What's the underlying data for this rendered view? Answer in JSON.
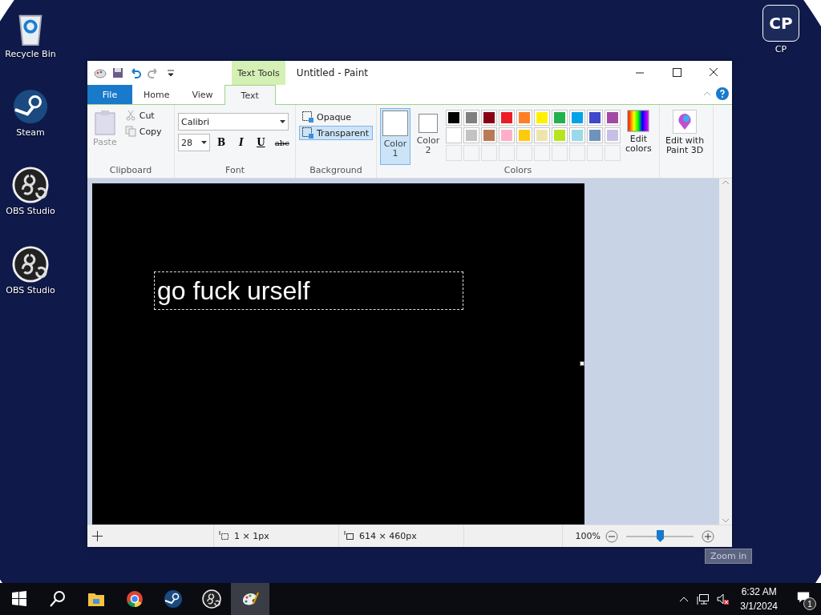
{
  "desktop_icons": [
    {
      "kind": "recycle",
      "label": "Recycle Bin"
    },
    {
      "kind": "steam",
      "label": "Steam"
    },
    {
      "kind": "obs",
      "label": "OBS Studio"
    },
    {
      "kind": "obs",
      "label": "OBS Studio"
    }
  ],
  "corner_icon": {
    "logo": "CP",
    "label": "CP"
  },
  "window": {
    "title": "Untitled - Paint",
    "contextual_tab": "Text Tools",
    "tabs": [
      {
        "label": "File",
        "kind": "file",
        "selected": false
      },
      {
        "label": "Home",
        "kind": "tab",
        "selected": false
      },
      {
        "label": "View",
        "kind": "tab",
        "selected": false
      },
      {
        "label": "Text",
        "kind": "tab",
        "selected": true
      }
    ],
    "clipboard": {
      "label": "Clipboard",
      "paste": "Paste",
      "cut": "Cut",
      "copy": "Copy",
      "disabled": true
    },
    "font": {
      "label": "Font",
      "family": "Calibri",
      "size": "28",
      "bold": "B",
      "italic": "I",
      "underline": "U",
      "strikethrough": "abc"
    },
    "background": {
      "label": "Background",
      "options": [
        {
          "label": "Opaque",
          "selected": false
        },
        {
          "label": "Transparent",
          "selected": true
        }
      ]
    },
    "colors": {
      "label": "Colors",
      "slots": [
        {
          "label": "Color\n1",
          "color": "#ffffff",
          "selected": true
        },
        {
          "label": "Color\n2",
          "color": "#ffffff",
          "selected": false
        }
      ],
      "palette": [
        {
          "color": "#000000"
        },
        {
          "color": "#7f7f7f"
        },
        {
          "color": "#880015"
        },
        {
          "color": "#ed1c24"
        },
        {
          "color": "#ff7f27"
        },
        {
          "color": "#fff200"
        },
        {
          "color": "#22b14c"
        },
        {
          "color": "#00a2e8"
        },
        {
          "color": "#3f48cc"
        },
        {
          "color": "#a349a4"
        },
        {
          "color": "#ffffff"
        },
        {
          "color": "#c3c3c3"
        },
        {
          "color": "#b97a57"
        },
        {
          "color": "#ffaec9"
        },
        {
          "color": "#ffc90e"
        },
        {
          "color": "#efe4b0"
        },
        {
          "color": "#b5e61d"
        },
        {
          "color": "#99d9ea"
        },
        {
          "color": "#7092be"
        },
        {
          "color": "#c8bfe7"
        }
      ],
      "edit_colors": "Edit\ncolors"
    },
    "paint3d": "Edit with\nPaint 3D",
    "canvas_text": "go fuck urself",
    "status_bar": {
      "selection": "1 × 1px",
      "size": "614 × 460px",
      "zoom": "100%",
      "zoom_slider": {
        "level": 0.5
      },
      "tooltip": "Zoom in"
    }
  },
  "taskbar": {
    "items": [
      {
        "kind": "start",
        "active": false
      },
      {
        "kind": "search",
        "active": false
      },
      {
        "kind": "explorer",
        "active": false
      },
      {
        "kind": "chrome",
        "active": false
      },
      {
        "kind": "steam",
        "active": false
      },
      {
        "kind": "obs",
        "active": false
      },
      {
        "kind": "paint",
        "active": true
      }
    ],
    "time": "6:32 AM",
    "date": "3/1/2024",
    "notifications": "1"
  }
}
